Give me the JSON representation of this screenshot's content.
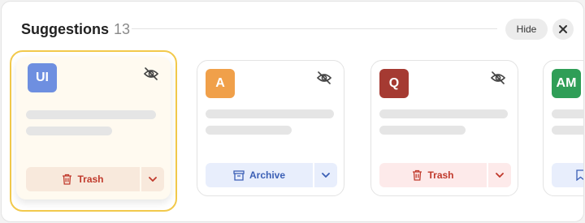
{
  "header": {
    "title": "Suggestions",
    "count": "13",
    "hide_label": "Hide"
  },
  "colors": {
    "selected_border": "#f2c94c",
    "trash": "#c0392b",
    "archive": "#3b5fb5"
  },
  "cards": [
    {
      "initials": "UI",
      "avatar_color": "#6e8fe0",
      "action": "Trash",
      "action_icon": "trash-icon"
    },
    {
      "initials": "A",
      "avatar_color": "#f0a04a",
      "action": "Archive",
      "action_icon": "archive-icon"
    },
    {
      "initials": "Q",
      "avatar_color": "#a53a32",
      "action": "Trash",
      "action_icon": "trash-icon"
    },
    {
      "initials": "AM",
      "avatar_color": "#2f9e57",
      "action": "",
      "action_icon": "bookmark-icon"
    }
  ]
}
